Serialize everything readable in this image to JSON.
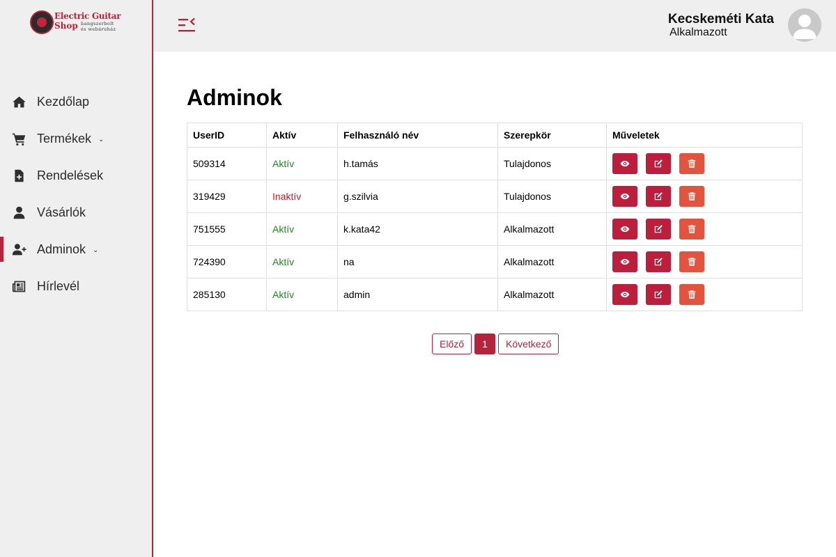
{
  "logo": {
    "line1": "Electric Guitar",
    "line2": "Shop",
    "sub1": "hangszerbolt",
    "sub2": "és webáruház"
  },
  "sidebar": {
    "items": [
      {
        "label": "Kezdőlap",
        "icon": "home-icon"
      },
      {
        "label": "Termékek",
        "icon": "cart-icon",
        "caret": "⌄"
      },
      {
        "label": "Rendelések",
        "icon": "file-plus-icon"
      },
      {
        "label": "Vásárlók",
        "icon": "user-icon"
      },
      {
        "label": "Adminok",
        "icon": "user-plus-icon",
        "caret": "⌄"
      },
      {
        "label": "Hírlevél",
        "icon": "newspaper-icon"
      }
    ]
  },
  "header": {
    "user_name": "Kecskeméti Kata",
    "user_role": "Alkalmazott"
  },
  "main": {
    "title": "Adminok",
    "table": {
      "headers": [
        "UserID",
        "Aktív",
        "Felhasználó név",
        "Szerepkör",
        "Műveletek"
      ],
      "rows": [
        {
          "id": "509314",
          "status": "Aktív",
          "username": "h.tamás",
          "role": "Tulajdonos"
        },
        {
          "id": "319429",
          "status": "Inaktív",
          "username": "g.szilvia",
          "role": "Tulajdonos"
        },
        {
          "id": "751555",
          "status": "Aktív",
          "username": "k.kata42",
          "role": "Alkalmazott"
        },
        {
          "id": "724390",
          "status": "Aktív",
          "username": "na",
          "role": "Alkalmazott"
        },
        {
          "id": "285130",
          "status": "Aktív",
          "username": "admin",
          "role": "Alkalmazott"
        }
      ]
    },
    "pagination": {
      "prev": "Előző",
      "current": "1",
      "next": "Következő"
    }
  },
  "colors": {
    "accent": "#b5233c",
    "delete": "#e3533d",
    "active": "#1f8a1f",
    "inactive": "#d3182b"
  }
}
